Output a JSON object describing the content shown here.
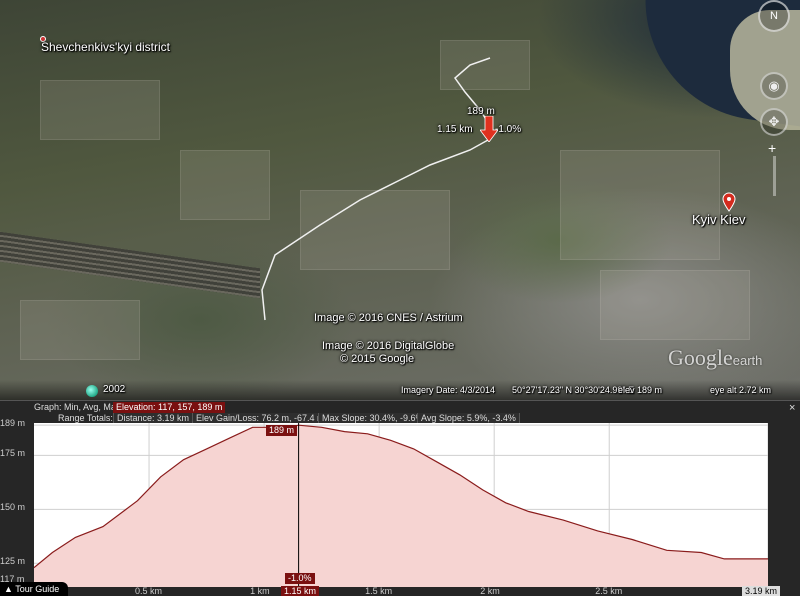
{
  "map": {
    "district_label": "Shevchenkivs'kyi district",
    "city_label": "Kyiv  Kiev",
    "route_elev": "189 m",
    "route_dist": "1.15 km",
    "route_slope": "-1.0%",
    "copyright_1": "Image © 2016 CNES / Astrium",
    "copyright_2": "Image © 2016 DigitalGlobe",
    "copyright_3": "© 2015 Google",
    "logo_main": "Google",
    "logo_sub": "earth",
    "compass": "N",
    "history_year": "2002",
    "imagery_date": "Imagery Date: 4/3/2014",
    "coords": "50°27'17.23\" N  30°30'24.99\" E",
    "elev": "elev   189 m",
    "eye_alt": "eye alt   2.72 km"
  },
  "profile": {
    "graph_label": "Graph: Min, Avg, Max",
    "elevation_stats": "Elevation: 117, 157, 189 m",
    "range_totals_label": "Range Totals:",
    "distance": "Distance: 3.19 km",
    "elev_gain_loss": "Elev Gain/Loss: 76.2 m, -67.4 m",
    "max_slope": "Max Slope: 30.4%, -9.6%",
    "avg_slope": "Avg Slope: 5.9%, -3.4%",
    "close": "×",
    "cursor_elev": "189 m",
    "cursor_slope": "-1.0%",
    "cursor_dist": "1.15 km",
    "tour_guide": "Tour Guide",
    "colors": {
      "fill": "#f6d4d2",
      "line": "#8a1c1c",
      "chip": "#7a1010"
    }
  },
  "chart_data": {
    "type": "area",
    "title": "",
    "xlabel": "",
    "ylabel": "",
    "x_unit": "km",
    "y_unit": "m",
    "xlim": [
      0,
      3.19
    ],
    "ylim": [
      114,
      190
    ],
    "y_ticks": [
      "189 m",
      "175 m",
      "150 m",
      "125 m",
      "117 m"
    ],
    "y_tick_values": [
      189,
      175,
      150,
      125,
      117
    ],
    "x_ticks": [
      "0.5 km",
      "1 km",
      "1.15 km",
      "1.5 km",
      "2 km",
      "2.5 km",
      "3.19 km"
    ],
    "x_tick_values": [
      0.5,
      1.0,
      1.15,
      1.5,
      2.0,
      2.5,
      3.19
    ],
    "grid": true,
    "cursor_x": 1.15,
    "series": [
      {
        "x": [
          0,
          0.08,
          0.18,
          0.3,
          0.45,
          0.55,
          0.65,
          0.75,
          0.85,
          0.95,
          1.0,
          1.1,
          1.15,
          1.25,
          1.35,
          1.45,
          1.55,
          1.65,
          1.75,
          1.85,
          1.95,
          2.05,
          2.15,
          2.3,
          2.45,
          2.6,
          2.75,
          2.9,
          3.0,
          3.1,
          3.19
        ],
        "y": [
          123,
          130,
          137,
          142,
          154,
          165,
          173,
          178,
          183,
          188,
          188,
          188,
          189,
          188,
          186,
          185,
          182,
          178,
          172,
          166,
          159,
          153,
          149,
          145,
          140,
          136,
          131,
          130,
          127,
          127,
          127
        ]
      }
    ]
  }
}
